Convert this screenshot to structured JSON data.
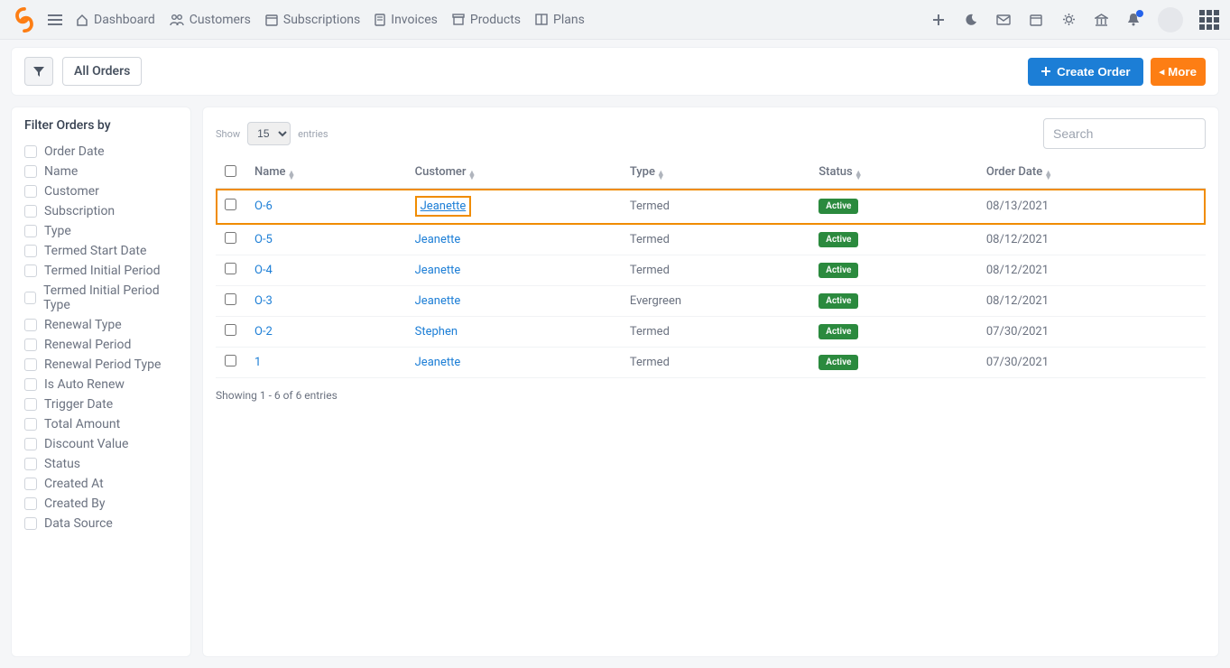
{
  "nav": {
    "items": [
      {
        "label": "Dashboard",
        "icon": "home-icon"
      },
      {
        "label": "Customers",
        "icon": "users-icon"
      },
      {
        "label": "Subscriptions",
        "icon": "calendar-icon"
      },
      {
        "label": "Invoices",
        "icon": "invoice-icon"
      },
      {
        "label": "Products",
        "icon": "archive-icon"
      },
      {
        "label": "Plans",
        "icon": "columns-icon"
      }
    ]
  },
  "toolbar": {
    "all_orders": "All Orders",
    "create_order": "Create Order",
    "more": "More"
  },
  "filters": {
    "title": "Filter Orders by",
    "items": [
      "Order Date",
      "Name",
      "Customer",
      "Subscription",
      "Type",
      "Termed Start Date",
      "Termed Initial Period",
      "Termed Initial Period Type",
      "Renewal Type",
      "Renewal Period",
      "Renewal Period Type",
      "Is Auto Renew",
      "Trigger Date",
      "Total Amount",
      "Discount Value",
      "Status",
      "Created At",
      "Created By",
      "Data Source"
    ]
  },
  "table": {
    "show_label": "Show",
    "entries_label": "entries",
    "page_size": "15",
    "search_placeholder": "Search",
    "columns": [
      "Name",
      "Customer",
      "Type",
      "Status",
      "Order Date"
    ],
    "rows": [
      {
        "name": "O-6",
        "customer": "Jeanette",
        "type": "Termed",
        "status": "Active",
        "date": "08/13/2021",
        "highlight_row": true,
        "highlight_customer": true
      },
      {
        "name": "O-5",
        "customer": "Jeanette",
        "type": "Termed",
        "status": "Active",
        "date": "08/12/2021"
      },
      {
        "name": "O-4",
        "customer": "Jeanette",
        "type": "Termed",
        "status": "Active",
        "date": "08/12/2021"
      },
      {
        "name": "O-3",
        "customer": "Jeanette",
        "type": "Evergreen",
        "status": "Active",
        "date": "08/12/2021"
      },
      {
        "name": "O-2",
        "customer": "Stephen",
        "type": "Termed",
        "status": "Active",
        "date": "07/30/2021"
      },
      {
        "name": "1",
        "customer": "Jeanette",
        "type": "Termed",
        "status": "Active",
        "date": "07/30/2021"
      }
    ],
    "footer": "Showing 1 - 6 of 6 entries"
  }
}
